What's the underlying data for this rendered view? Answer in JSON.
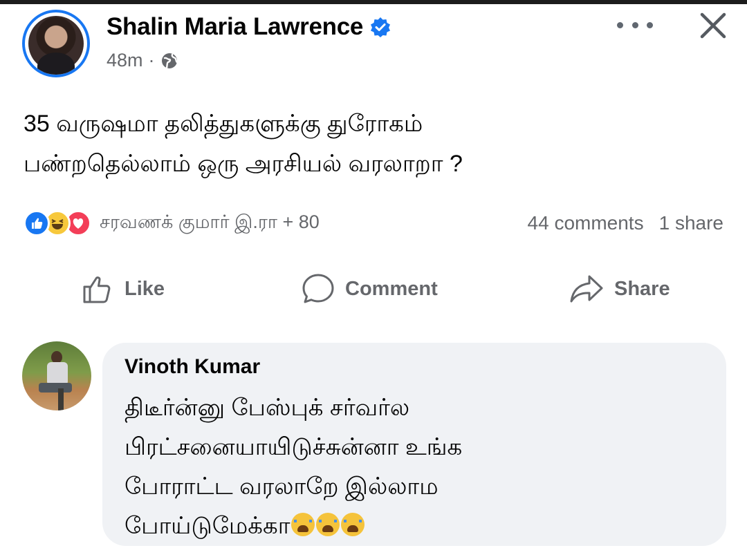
{
  "post": {
    "author_name": "Shalin Maria Lawrence",
    "time": "48m",
    "separator": "·",
    "text_lines": [
      "35 வருஷமா தலித்துகளுக்கு துரோகம்",
      "பண்றதெல்லாம் ஒரு அரசியல் வரலாறா ?"
    ],
    "reaction_names": "சரவணக் குமார் இ.ரா + 80",
    "comments_count": "44 comments",
    "shares_count": "1 share",
    "reactions": [
      "like",
      "haha",
      "love"
    ]
  },
  "actions": {
    "like": "Like",
    "comment": "Comment",
    "share": "Share"
  },
  "comment": {
    "author_name": "Vinoth Kumar",
    "text_lines": [
      "திடீர்ன்னு பேஸ்புக் சர்வர்ல",
      "பிரட்சனையாயிடுச்சுன்னா உங்க",
      "போராட்ட வரலாறே இல்லாம",
      "போய்டுமேக்கா"
    ],
    "emoji": [
      "loudly-crying-face",
      "loudly-crying-face",
      "loudly-crying-face"
    ]
  },
  "colors": {
    "accent": "#1877f2",
    "secondary_text": "#65676b",
    "bubble": "#f0f2f5"
  }
}
